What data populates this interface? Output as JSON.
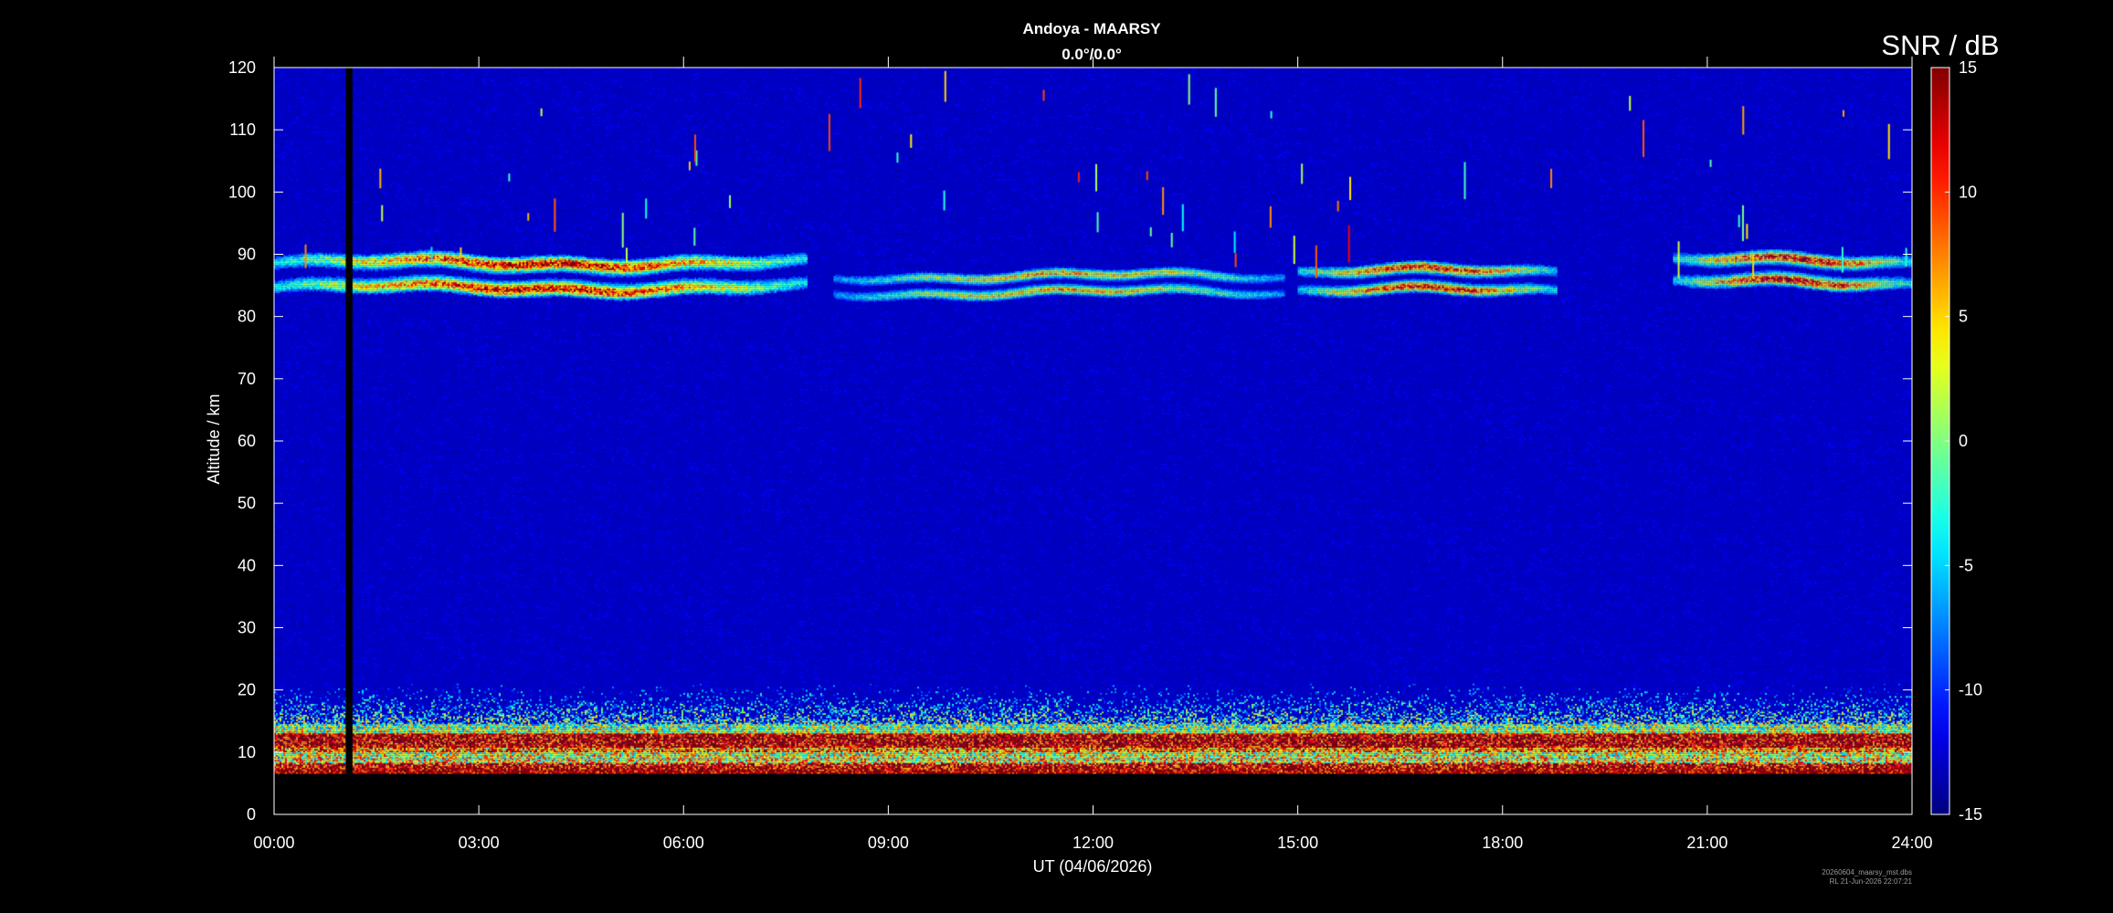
{
  "chart_data": {
    "type": "heatmap",
    "title": "Andoya - MAARSY",
    "subtitle": "0.0°/0.0°",
    "xlabel": "UT (04/06/2026)",
    "ylabel": "Altitude / km",
    "colorbar_label": "SNR / dB",
    "x_ticks": [
      "00:00",
      "03:00",
      "06:00",
      "09:00",
      "12:00",
      "15:00",
      "18:00",
      "21:00",
      "24:00"
    ],
    "x_range_hours": [
      0,
      24
    ],
    "y_ticks": [
      0,
      10,
      20,
      30,
      40,
      50,
      60,
      70,
      80,
      90,
      100,
      110,
      120
    ],
    "ylim": [
      0,
      120
    ],
    "colorbar_ticks": [
      15,
      10,
      5,
      0,
      -5,
      -10,
      -15
    ],
    "clim": [
      -15,
      15
    ],
    "colormap": "jet",
    "background_snr_db": -13,
    "data_gap": {
      "start_hour": 1.05,
      "end_hour": 1.15
    },
    "data_valid_min_altitude_km": 6.5,
    "features": [
      {
        "name": "PMSE",
        "start_hour": 0.0,
        "end_hour": 7.8,
        "alt_km": [
          82,
          91
        ],
        "peak_snr_db": 15
      },
      {
        "name": "PMSE",
        "start_hour": 8.2,
        "end_hour": 14.8,
        "alt_km": [
          82,
          88
        ],
        "peak_snr_db": 8
      },
      {
        "name": "PMSE",
        "start_hour": 15.0,
        "end_hour": 18.8,
        "alt_km": [
          82,
          89
        ],
        "peak_snr_db": 14
      },
      {
        "name": "PMSE",
        "start_hour": 20.5,
        "end_hour": 24.0,
        "alt_km": [
          83,
          91
        ],
        "peak_snr_db": 15
      },
      {
        "name": "Tropo/strato echoes",
        "start_hour": 0.0,
        "end_hour": 24.0,
        "alt_km": [
          6.5,
          21
        ],
        "peak_snr_db": 15
      }
    ],
    "grid": false
  },
  "footer": {
    "filename": "20260604_maarsy_mst.dbs",
    "stamp": "RL 21-Jun-2026 22:07:21"
  },
  "colors": {
    "background": "#000000",
    "axis": "#ffffff",
    "text": "#ffffff",
    "footer_text": "#9a9a9a"
  }
}
